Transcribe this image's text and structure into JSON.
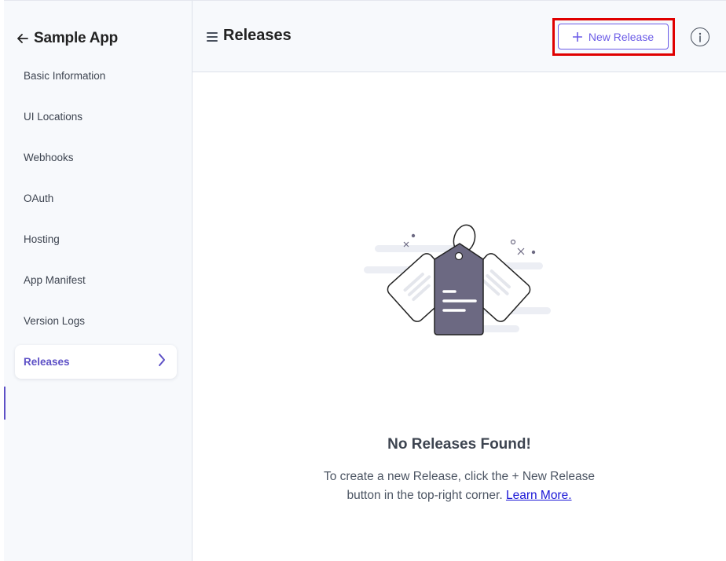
{
  "sidebar": {
    "app_title": "Sample App",
    "items": [
      {
        "label": "Basic Information"
      },
      {
        "label": "UI Locations"
      },
      {
        "label": "Webhooks"
      },
      {
        "label": "OAuth"
      },
      {
        "label": "Hosting"
      },
      {
        "label": "App Manifest"
      },
      {
        "label": "Version Logs"
      },
      {
        "label": "Releases",
        "active": true
      }
    ]
  },
  "header": {
    "title": "Releases",
    "new_release_label": "New Release"
  },
  "empty_state": {
    "title": "No Releases Found!",
    "line1": "To create a new Release, click the + New Release",
    "line2_prefix": "button in the top-right corner. ",
    "learn_more": "Learn More."
  },
  "icons": {
    "back": "arrow-left-icon",
    "menu": "hamburger-icon",
    "add": "plus-icon",
    "info": "info-icon",
    "chevron": "chevron-right-icon",
    "illustration": "tags-illustration"
  },
  "colors": {
    "accent": "#6c5ce7",
    "active_nav": "#5d50c6",
    "highlight": "#e00000",
    "link": "#1a16d6",
    "tag_dark": "#6c6982"
  }
}
